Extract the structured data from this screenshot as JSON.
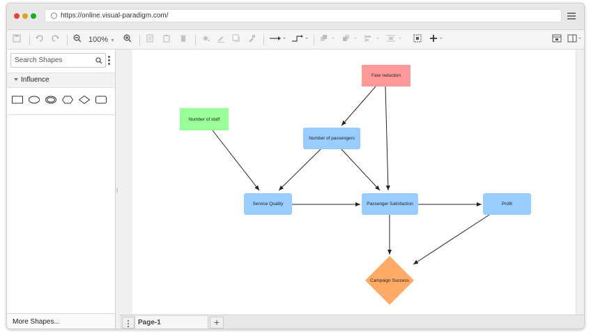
{
  "browser": {
    "url": "https://online.visual-paradigm.com/",
    "dot_colors": [
      "#e0443e",
      "#dea123",
      "#1aab29"
    ]
  },
  "toolbar": {
    "zoom": "100%"
  },
  "sidebar": {
    "search_placeholder": "Search Shapes",
    "section_title": "Influence",
    "more_shapes": "More Shapes..."
  },
  "pages": {
    "current": "Page-1"
  },
  "diagram": {
    "nodes": {
      "fare_reduction": "Fare reduction",
      "number_of_staff": "Number of staff",
      "number_of_passengers": "Number of passengers",
      "service_quality": "Service Quality",
      "passenger_satisfaction": "Passenger Satisfaction",
      "profit": "Profit",
      "campaign_success": "Campaign Success"
    },
    "colors": {
      "red_node": "#ff9999",
      "green_node": "#99ff99",
      "blue_node": "#99ccff",
      "orange_node": "#ffaa66"
    }
  }
}
